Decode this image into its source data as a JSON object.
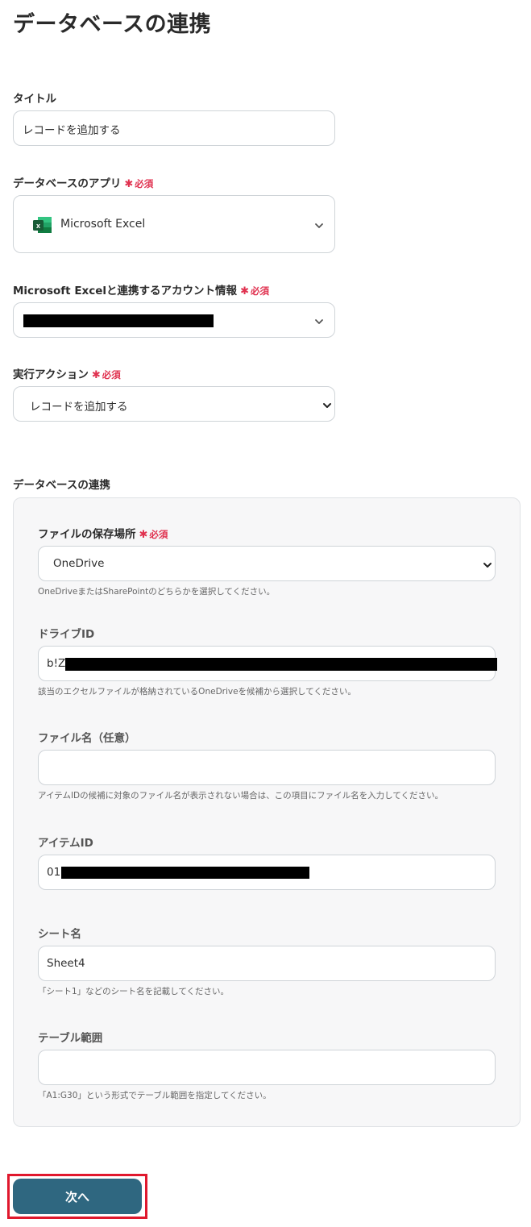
{
  "page": {
    "title": "データベースの連携"
  },
  "required_label": "必須",
  "form": {
    "title_field": {
      "label": "タイトル",
      "value": "レコードを追加する"
    },
    "app_field": {
      "label": "データベースのアプリ",
      "value": "Microsoft Excel",
      "icon": "excel-icon"
    },
    "account_field": {
      "label": "Microsoft Excelと連携するアカウント情報"
    },
    "action_field": {
      "label": "実行アクション",
      "value": "レコードを追加する"
    }
  },
  "section": {
    "title": "データベースの連携",
    "storage": {
      "label": "ファイルの保存場所",
      "value": "OneDrive",
      "help": "OneDriveまたはSharePointのどちらかを選択してください。"
    },
    "drive_id": {
      "label": "ドライブID",
      "value": "b!Z",
      "help": "該当のエクセルファイルが格納されているOneDriveを候補から選択してください。"
    },
    "file_name": {
      "label": "ファイル名（任意）",
      "value": "",
      "help": "アイテムIDの候補に対象のファイル名が表示されない場合は、この項目にファイル名を入力してください。"
    },
    "item_id": {
      "label": "アイテムID",
      "value": "01"
    },
    "sheet_name": {
      "label": "シート名",
      "value": "Sheet4",
      "help": "「シート1」などのシート名を記載してください。"
    },
    "table_range": {
      "label": "テーブル範囲",
      "value": "",
      "help": "「A1:G30」という形式でテーブル範囲を指定してください。"
    }
  },
  "next_button": {
    "label": "次へ"
  },
  "colors": {
    "accent": "#2f6780",
    "required": "#e0314f",
    "highlight": "#e0182d",
    "excel_green": "#1e7145"
  }
}
